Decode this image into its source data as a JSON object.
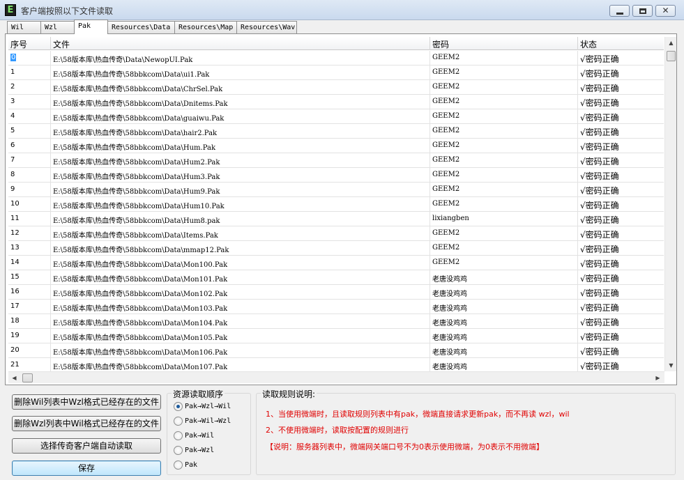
{
  "window": {
    "title": "客户端按照以下文件读取",
    "app_icon_letter": "E",
    "min_glyph": "",
    "max_glyph": "",
    "close_glyph": "✕"
  },
  "tabs": [
    {
      "label": "Wil",
      "active": false
    },
    {
      "label": "Wzl",
      "active": false
    },
    {
      "label": "Pak",
      "active": true
    },
    {
      "label": "Resources\\Data",
      "active": false
    },
    {
      "label": "Resources\\Map",
      "active": false
    },
    {
      "label": "Resources\\Wav",
      "active": false
    }
  ],
  "table": {
    "columns": [
      "序号",
      "文件",
      "密码",
      "状态"
    ],
    "rows": [
      [
        "0",
        "E:\\58版本库\\热血传奇\\Data\\NewopUI.Pak",
        "GEEM2",
        "√密码正确"
      ],
      [
        "1",
        "E:\\58版本库\\热血传奇\\58bbkcom\\Data\\ui1.Pak",
        "GEEM2",
        "√密码正确"
      ],
      [
        "2",
        "E:\\58版本库\\热血传奇\\58bbkcom\\Data\\ChrSel.Pak",
        "GEEM2",
        "√密码正确"
      ],
      [
        "3",
        "E:\\58版本库\\热血传奇\\58bbkcom\\Data\\Dnitems.Pak",
        "GEEM2",
        "√密码正确"
      ],
      [
        "4",
        "E:\\58版本库\\热血传奇\\58bbkcom\\Data\\guaiwu.Pak",
        "GEEM2",
        "√密码正确"
      ],
      [
        "5",
        "E:\\58版本库\\热血传奇\\58bbkcom\\Data\\hair2.Pak",
        "GEEM2",
        "√密码正确"
      ],
      [
        "6",
        "E:\\58版本库\\热血传奇\\58bbkcom\\Data\\Hum.Pak",
        "GEEM2",
        "√密码正确"
      ],
      [
        "7",
        "E:\\58版本库\\热血传奇\\58bbkcom\\Data\\Hum2.Pak",
        "GEEM2",
        "√密码正确"
      ],
      [
        "8",
        "E:\\58版本库\\热血传奇\\58bbkcom\\Data\\Hum3.Pak",
        "GEEM2",
        "√密码正确"
      ],
      [
        "9",
        "E:\\58版本库\\热血传奇\\58bbkcom\\Data\\Hum9.Pak",
        "GEEM2",
        "√密码正确"
      ],
      [
        "10",
        "E:\\58版本库\\热血传奇\\58bbkcom\\Data\\Hum10.Pak",
        "GEEM2",
        "√密码正确"
      ],
      [
        "11",
        "E:\\58版本库\\热血传奇\\58bbkcom\\Data\\Hum8.pak",
        "lixiangben",
        "√密码正确"
      ],
      [
        "12",
        "E:\\58版本库\\热血传奇\\58bbkcom\\Data\\Items.Pak",
        "GEEM2",
        "√密码正确"
      ],
      [
        "13",
        "E:\\58版本库\\热血传奇\\58bbkcom\\Data\\mmap12.Pak",
        "GEEM2",
        "√密码正确"
      ],
      [
        "14",
        "E:\\58版本库\\热血传奇\\58bbkcom\\Data\\Mon100.Pak",
        "GEEM2",
        "√密码正确"
      ],
      [
        "15",
        "E:\\58版本库\\热血传奇\\58bbkcom\\Data\\Mon101.Pak",
        "老唐没鸡鸡",
        "√密码正确"
      ],
      [
        "16",
        "E:\\58版本库\\热血传奇\\58bbkcom\\Data\\Mon102.Pak",
        "老唐没鸡鸡",
        "√密码正确"
      ],
      [
        "17",
        "E:\\58版本库\\热血传奇\\58bbkcom\\Data\\Mon103.Pak",
        "老唐没鸡鸡",
        "√密码正确"
      ],
      [
        "18",
        "E:\\58版本库\\热血传奇\\58bbkcom\\Data\\Mon104.Pak",
        "老唐没鸡鸡",
        "√密码正确"
      ],
      [
        "19",
        "E:\\58版本库\\热血传奇\\58bbkcom\\Data\\Mon105.Pak",
        "老唐没鸡鸡",
        "√密码正确"
      ],
      [
        "20",
        "E:\\58版本库\\热血传奇\\58bbkcom\\Data\\Mon106.Pak",
        "老唐没鸡鸡",
        "√密码正确"
      ],
      [
        "21",
        "E:\\58版本库\\热血传奇\\58bbkcom\\Data\\Mon107.Pak",
        "老唐没鸡鸡",
        "√密码正确"
      ]
    ],
    "selected_index": 0
  },
  "scrollbar": {
    "up_glyph": "▲",
    "down_glyph": "▼",
    "left_glyph": "◀",
    "right_glyph": "▶"
  },
  "buttons": {
    "delete_wil": "删除Wil列表中Wzl格式已经存在的文件",
    "delete_wzl": "删除Wzl列表中Wil格式已经存在的文件",
    "select_auto": "选择传奇客户端自动读取",
    "save": "保存"
  },
  "order": {
    "title": "资源读取顺序",
    "options": [
      {
        "label": "Pak→Wzl→Wil",
        "checked": true
      },
      {
        "label": "Pak→Wil→Wzl",
        "checked": false
      },
      {
        "label": "Pak→Wil",
        "checked": false
      },
      {
        "label": "Pak→Wzl",
        "checked": false
      },
      {
        "label": "Pak",
        "checked": false
      }
    ]
  },
  "rules": {
    "title": "读取规则说明:",
    "lines": [
      "1、当使用微端时，且读取规则列表中有pak，微端直接请求更新pak，而不再读 wzl，wil",
      "2、不使用微端时，读取按配置的规则进行",
      "【说明：服务器列表中，微端网关端口号不为0表示使用微端，为0表示不用微端】"
    ],
    "color": "#e00000"
  }
}
